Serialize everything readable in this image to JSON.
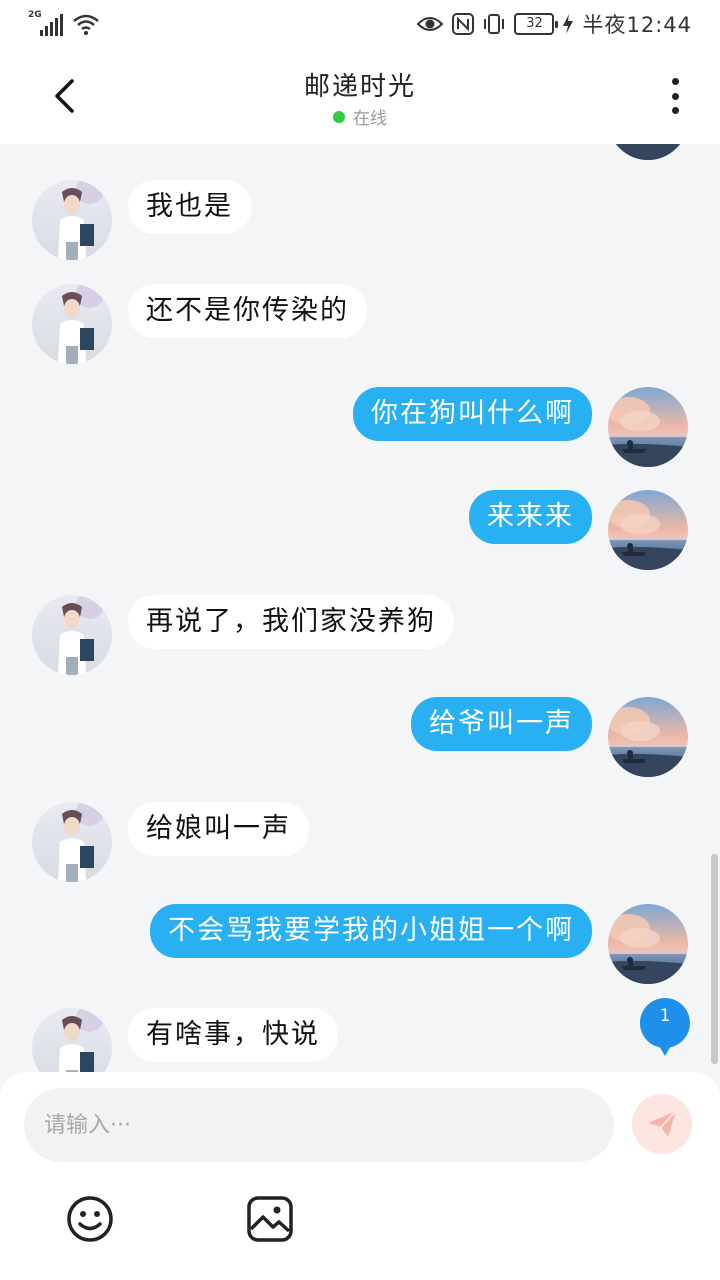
{
  "status_bar": {
    "network": "2G",
    "battery": "32",
    "time": "半夜12:44"
  },
  "header": {
    "title": "邮递时光",
    "presence": "在线",
    "back_icon": "chevron-left-icon",
    "more_icon": "more-vertical-icon"
  },
  "messages": [
    {
      "side": "left",
      "text": "我也是"
    },
    {
      "side": "left",
      "text": "还不是你传染的"
    },
    {
      "side": "right",
      "text": "你在狗叫什么啊"
    },
    {
      "side": "right",
      "text": "来来来"
    },
    {
      "side": "left",
      "text": "再说了，我们家没养狗"
    },
    {
      "side": "right",
      "text": "给爷叫一声"
    },
    {
      "side": "left",
      "text": "给娘叫一声"
    },
    {
      "side": "right",
      "text": "不会骂我要学我的小姐姐一个啊"
    },
    {
      "side": "left",
      "text": "有啥事，快说"
    }
  ],
  "unread_badge": "1",
  "composer": {
    "placeholder": "请输入···",
    "send_icon": "send-icon",
    "emoji_icon": "emoji-icon",
    "image_icon": "image-icon"
  },
  "colors": {
    "outgoing_bubble": "#29b0f3",
    "incoming_bubble": "#ffffff",
    "background": "#f4f5f7",
    "online_dot": "#2ecc40"
  }
}
